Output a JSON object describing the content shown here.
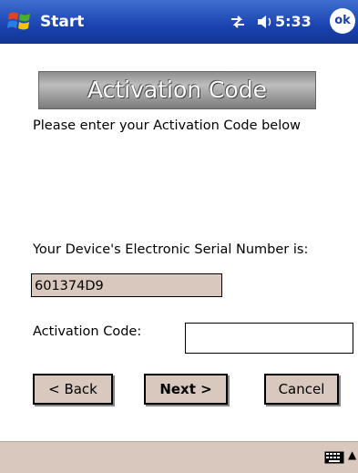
{
  "titlebar": {
    "start_label": "Start",
    "time": "5:33",
    "ok_label": "ok",
    "icons": [
      "windows-logo-icon",
      "connectivity-icon",
      "volume-icon"
    ]
  },
  "page": {
    "header": "Activation Code",
    "instruction": "Please enter your Activation Code below",
    "esn_label": "Your Device's Electronic Serial Number is:",
    "esn_value": "601374D9",
    "code_label": "Activation Code:",
    "code_value": ""
  },
  "buttons": {
    "back": "< Back",
    "next": "Next >",
    "cancel": "Cancel"
  },
  "taskbar": {
    "icons": [
      "keyboard-icon",
      "sip-arrow-icon"
    ],
    "sip_arrow": "▲"
  },
  "colors": {
    "titlebar_blue": "#1a43b0",
    "button_face": "#d9c8bd"
  }
}
